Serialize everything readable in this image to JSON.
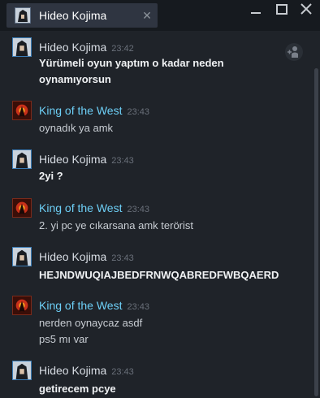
{
  "tab": {
    "title": "Hideo Kojima",
    "close_glyph": "✕",
    "avatar": "kojima-avatar"
  },
  "window": {
    "minimize": "minimize-icon",
    "maximize": "maximize-icon",
    "close": "close-icon"
  },
  "messages": [
    {
      "sender": "Hideo Kojima",
      "time": "23:42",
      "lines": [
        "Yürümeli oyun yaptım o kadar neden",
        "oynamıyorsun"
      ]
    },
    {
      "sender": "King of the West",
      "time": "23:43",
      "lines": [
        "oynadık ya amk"
      ]
    },
    {
      "sender": "Hideo Kojima",
      "time": "23:43",
      "lines": [
        "2yi ?"
      ]
    },
    {
      "sender": "King of the West",
      "time": "23:43",
      "lines": [
        "2. yi pc ye cıkarsana amk terörist"
      ]
    },
    {
      "sender": "Hideo Kojima",
      "time": "23:43",
      "lines": [
        "HEJNDWUQIAJBEDFRNWQABREDFWBQAERD"
      ]
    },
    {
      "sender": "King of the West",
      "time": "23:43",
      "lines": [
        "nerden oynaycaz asdf",
        "ps5 mı var"
      ]
    },
    {
      "sender": "Hideo Kojima",
      "time": "23:43",
      "lines": [
        "getirecem pcye"
      ]
    }
  ],
  "colors": {
    "friend_name": "#6dcff6",
    "self_name": "#d8dde4",
    "background": "#1f2329"
  }
}
